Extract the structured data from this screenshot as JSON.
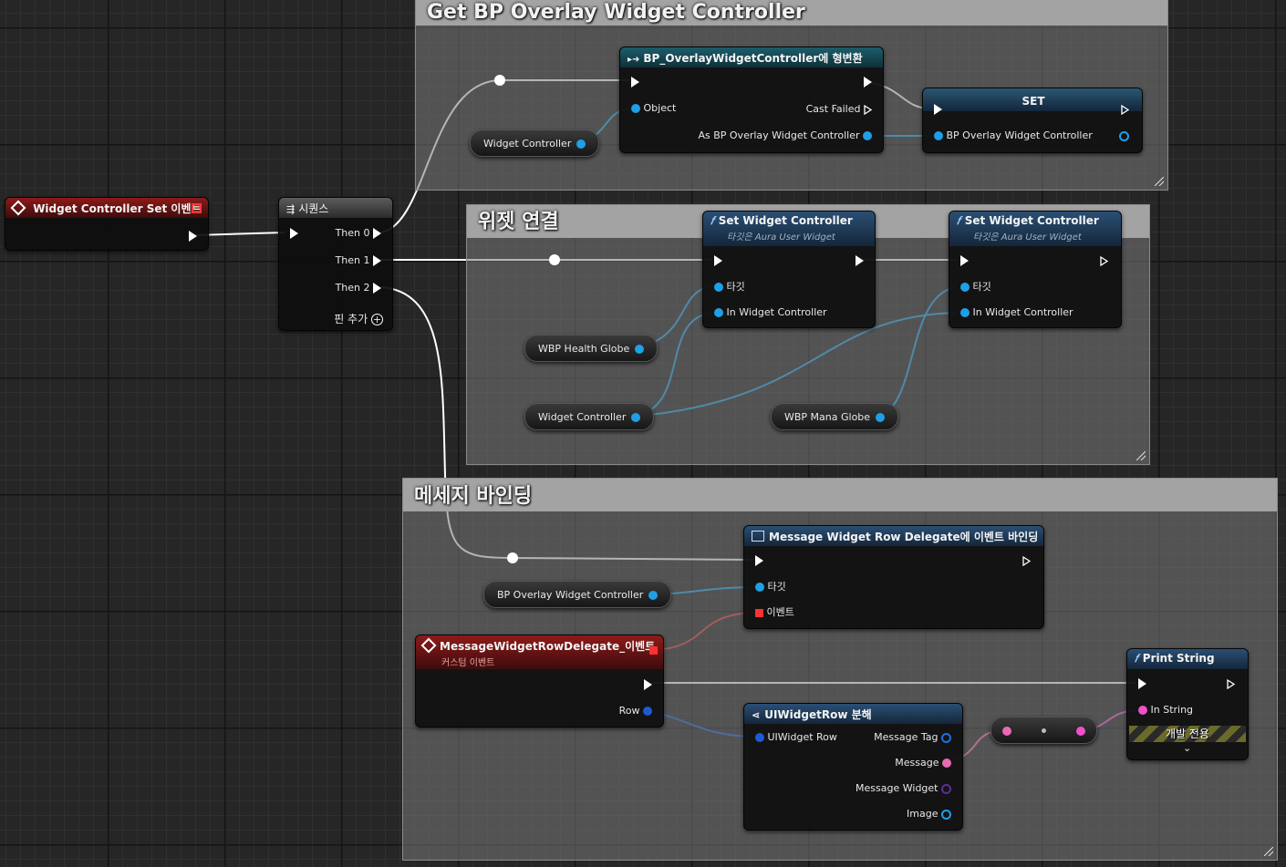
{
  "comments": {
    "overlay": "Get BP Overlay Widget Controller",
    "widget_connect": "위젯 연결",
    "message_binding": "메세지 바인딩"
  },
  "event_node": {
    "title": "Widget Controller Set 이벤트"
  },
  "sequence_node": {
    "title": "시퀀스",
    "outputs": [
      "Then 0",
      "Then 1",
      "Then 2"
    ],
    "add_pin": "핀 추가"
  },
  "cast_node": {
    "title": "BP_OverlayWidgetController에 형변환",
    "object": "Object",
    "cast_failed": "Cast Failed",
    "as_output": "As BP Overlay Widget Controller"
  },
  "set_node": {
    "title": "SET",
    "var": "BP Overlay Widget Controller"
  },
  "set_wc_1": {
    "title": "Set Widget Controller",
    "subtitle": "타깃은 Aura User Widget",
    "target": "타깃",
    "in_wc": "In Widget Controller"
  },
  "set_wc_2": {
    "title": "Set Widget Controller",
    "subtitle": "타깃은 Aura User Widget",
    "target": "타깃",
    "in_wc": "In Widget Controller"
  },
  "vars": {
    "widget_controller_top": "Widget Controller",
    "health_globe": "WBP Health Globe",
    "widget_controller_mid": "Widget Controller",
    "mana_globe": "WBP Mana Globe",
    "bp_overlay": "BP Overlay Widget Controller"
  },
  "bind_node": {
    "title": "Message Widget Row Delegate에 이벤트 바인딩",
    "target": "타깃",
    "event": "이벤트"
  },
  "custom_event": {
    "title": "MessageWidgetRowDelegate_이벤트",
    "subtitle": "커스텀 이벤트",
    "row": "Row"
  },
  "break_node": {
    "title": "UIWidgetRow 분해",
    "input": "UIWidget Row",
    "outputs": [
      "Message Tag",
      "Message",
      "Message Widget",
      "Image"
    ]
  },
  "print_node": {
    "title": "Print String",
    "in_string": "In String",
    "dev_only": "개발 전용"
  },
  "colors": {
    "object_pin": "#1ea0e6",
    "exec": "#ffffff",
    "string_pin": "#f050c8",
    "struct_pin": "#1e5ad2",
    "delegate_pin": "#ff3838",
    "text_pin": "#e86ab4",
    "tag_pin": "#1e6ee6",
    "class_pin": "#5a2d9a"
  }
}
